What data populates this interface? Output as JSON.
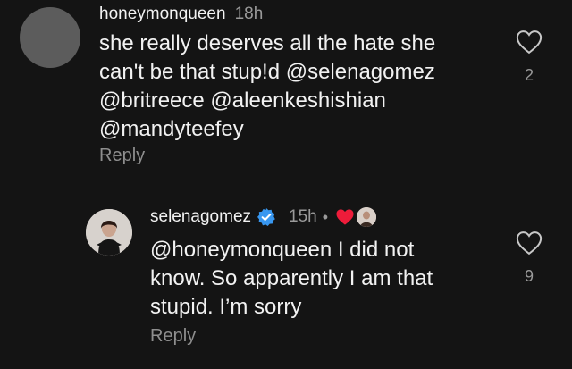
{
  "comments": [
    {
      "username": "honeymonqueen",
      "time": "18h",
      "lines": [
        "she really deserves all the hate she",
        "can't be that stup!d @selenagomez",
        "@britreece @aleenkeshishian",
        "@mandyteefey"
      ],
      "reply_label": "Reply",
      "like_icon": "heart-outline-icon",
      "like_count": "2"
    },
    {
      "username": "selenagomez",
      "time": "15h",
      "separator": "•",
      "verified_icon": "verified-badge-icon",
      "liked_by_creator_icon": "red-heart-icon",
      "lines": [
        "@honeymonqueen I did not",
        "know. So apparently I am that",
        "stupid. I’m sorry"
      ],
      "reply_label": "Reply",
      "like_icon": "heart-outline-icon",
      "like_count": "9"
    }
  ],
  "colors": {
    "background": "#141414",
    "text": "#f2f2f2",
    "muted": "#9a9a9a",
    "verified": "#3897f0",
    "heart_red": "#ed1c3a"
  }
}
